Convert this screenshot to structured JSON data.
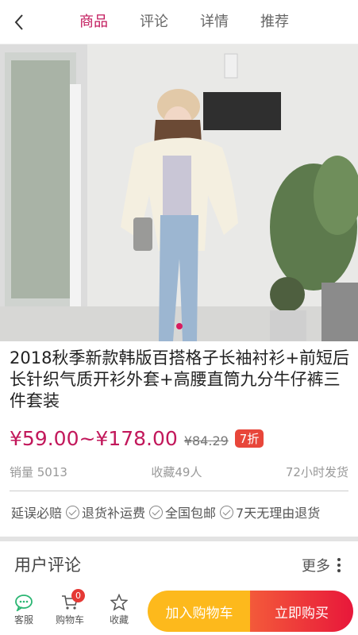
{
  "header": {
    "tabs": [
      {
        "label": "商品",
        "active": true
      },
      {
        "label": "评论",
        "active": false
      },
      {
        "label": "详情",
        "active": false
      },
      {
        "label": "推荐",
        "active": false
      }
    ]
  },
  "product": {
    "title": "2018秋季新款韩版百搭格子长袖衬衫+前短后长针织气质开衫外套+高腰直筒九分牛仔裤三件套装",
    "price": "¥59.00~¥178.00",
    "original_price": "¥84.29",
    "discount": "7折",
    "sales": "销量 5013",
    "favorites": "收藏49人",
    "shipping": "72小时发货",
    "services": [
      "延误必赔",
      "退货补运费",
      "全国包邮",
      "7天无理由退货"
    ]
  },
  "reviews": {
    "title": "用户评论",
    "more": "更多"
  },
  "bottom_bar": {
    "service_label": "客服",
    "cart_label": "购物车",
    "cart_count": "0",
    "favorite_label": "收藏",
    "add_to_cart": "加入购物车",
    "buy_now": "立即购买"
  },
  "colors": {
    "accent": "#c2185b",
    "discount_badge": "#e8463a",
    "cart_button": "#fdb91c",
    "buy_button": "#e8173a"
  }
}
